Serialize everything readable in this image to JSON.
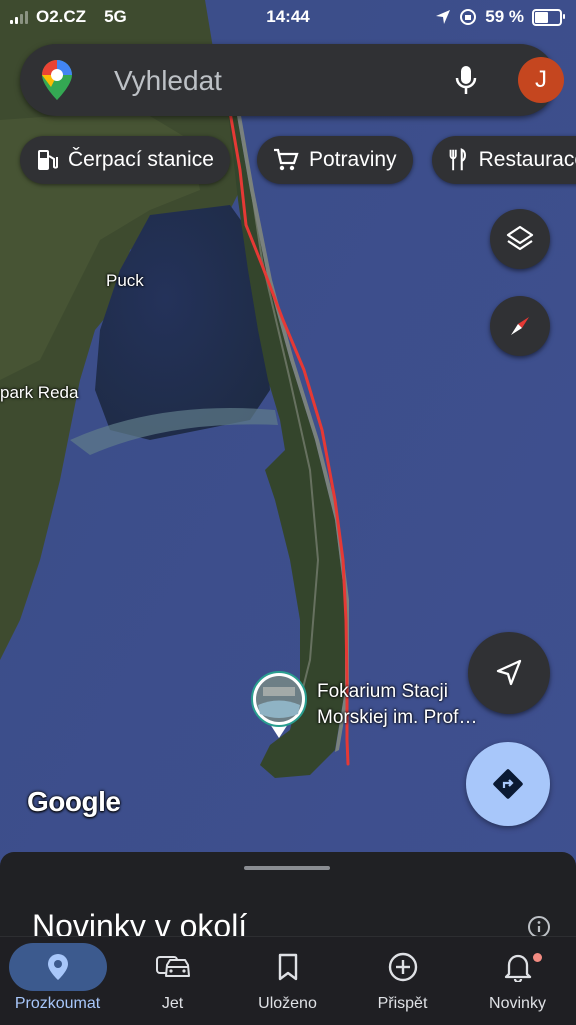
{
  "status_bar": {
    "carrier": "O2.CZ",
    "network": "5G",
    "time": "14:44",
    "battery": "59 %",
    "battery_level": 0.59
  },
  "search": {
    "placeholder": "Vyhledat",
    "avatar_letter": "J"
  },
  "chips": [
    {
      "label": "Čerpací stanice",
      "icon": "gas-station-icon"
    },
    {
      "label": "Potraviny",
      "icon": "cart-icon"
    },
    {
      "label": "Restaurace",
      "icon": "restaurant-icon"
    }
  ],
  "map": {
    "town_labels": [
      "Puck",
      "park Reda"
    ],
    "poi": {
      "line1": "Fokarium Stacji",
      "line2": "Morskiej im. Prof…"
    },
    "google_logo": "Google"
  },
  "sheet": {
    "title": "Novinky v okolí"
  },
  "nav": [
    {
      "label": "Prozkoumat",
      "icon": "pin-icon",
      "active": true
    },
    {
      "label": "Jet",
      "icon": "car-icon",
      "active": false
    },
    {
      "label": "Uloženo",
      "icon": "bookmark-icon",
      "active": false
    },
    {
      "label": "Přispět",
      "icon": "add-circle-icon",
      "active": false
    },
    {
      "label": "Novinky",
      "icon": "bell-icon",
      "active": false
    }
  ],
  "colors": {
    "route": "#e53935",
    "sea": "#3d4f8a",
    "land": "#3b4a2e",
    "accent": "#a8c7fa",
    "avatar": "#c5461f"
  }
}
